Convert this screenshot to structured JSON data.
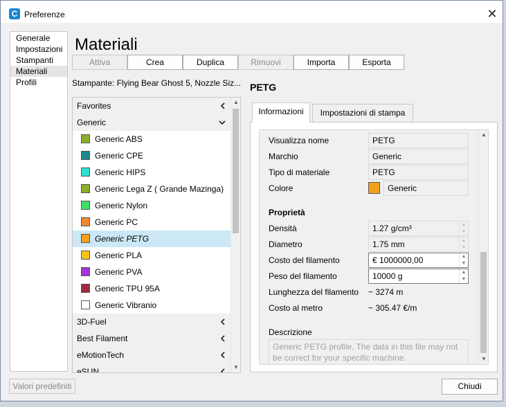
{
  "window": {
    "title": "Preferenze"
  },
  "nav": {
    "items": [
      "Generale",
      "Impostazioni",
      "Stampanti",
      "Materiali",
      "Profili"
    ],
    "selected": "Materiali"
  },
  "heading": "Materiali",
  "toolbar": {
    "activate": "Attiva",
    "create": "Crea",
    "duplicate": "Duplica",
    "remove": "Rimuovi",
    "import": "Importa",
    "export": "Esporta"
  },
  "printer_line": "Stampante: Flying Bear Ghost 5, Nozzle Siz...",
  "material_list": {
    "favorites": "Favorites",
    "generic": "Generic",
    "items": [
      {
        "label": "Generic ABS",
        "color": "#8bae2b"
      },
      {
        "label": "Generic CPE",
        "color": "#1c8a8c"
      },
      {
        "label": "Generic HIPS",
        "color": "#2fe0d0"
      },
      {
        "label": "Generic Lega Z ( Grande Mazinga)",
        "color": "#8bae2b"
      },
      {
        "label": "Generic Nylon",
        "color": "#3fe06a"
      },
      {
        "label": "Generic PC",
        "color": "#f08a35"
      },
      {
        "label": "Generic PETG",
        "color": "#f4a21c"
      },
      {
        "label": "Generic PLA",
        "color": "#f7c21a"
      },
      {
        "label": "Generic PVA",
        "color": "#a335d9"
      },
      {
        "label": "Generic TPU 95A",
        "color": "#a12a3d"
      },
      {
        "label": "Generic Vibranio",
        "color": "#ffffff"
      }
    ],
    "selected": "Generic PETG",
    "other_groups": [
      "3D-Fuel",
      "Best Filament",
      "eMotionTech",
      "eSUN"
    ]
  },
  "material_title": "PETG",
  "tabs": {
    "info": "Informazioni",
    "print": "Impostazioni di stampa"
  },
  "info": {
    "display_name_label": "Visualizza nome",
    "display_name_value": "PETG",
    "brand_label": "Marchio",
    "brand_value": "Generic",
    "type_label": "Tipo di materiale",
    "type_value": "PETG",
    "color_label": "Colore",
    "color_value": "Generic",
    "color_swatch": "#f4a21c",
    "properties_header": "Proprietà",
    "density_label": "Densità",
    "density_value": "1.27 g/cm³",
    "diameter_label": "Diametro",
    "diameter_value": "1.75 mm",
    "cost_label": "Costo del filamento",
    "cost_value": "€ 1000000,00",
    "weight_label": "Peso del filamento",
    "weight_value": "10000 g",
    "length_label": "Lunghezza del filamento",
    "length_value": "~ 3274 m",
    "cost_per_meter_label": "Costo al metro",
    "cost_per_meter_value": "~ 305.47 €/m",
    "description_label": "Descrizione",
    "description_value": "Generic PETG profile. The data in this file may not be correct for your specific machine."
  },
  "footer": {
    "defaults": "Valori predefiniti",
    "close": "Chiudi"
  }
}
